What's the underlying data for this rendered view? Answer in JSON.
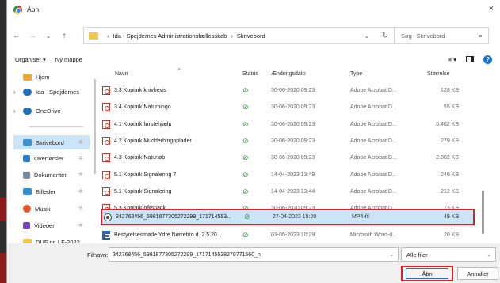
{
  "window": {
    "title": "Åbn",
    "close": "×"
  },
  "nav": {
    "back": "←",
    "forward": "→",
    "recent": "⌄",
    "up": "↑",
    "path": [
      "Ida - Spejdernes Administrationsfællesskab",
      "Skrivebord"
    ],
    "search_placeholder": "Søg i Skrivebord"
  },
  "toolbar": {
    "organize": "Organiser ▾",
    "new_folder": "Ny mappe"
  },
  "sidebar": {
    "items": [
      {
        "label": "Hjem",
        "icon": "home-icon",
        "color": "#f0a830"
      },
      {
        "label": "Ida - Spejdernes",
        "icon": "cloud-icon",
        "color": "#1f6fb8",
        "expand": "›"
      },
      {
        "label": "OneDrive",
        "icon": "cloud-icon",
        "color": "#1f6fb8",
        "expand": "›"
      },
      {
        "label": "Skrivebord",
        "icon": "desktop-icon",
        "color": "#3d8fd1",
        "pin": "✲",
        "selected": true
      },
      {
        "label": "Overførsler",
        "icon": "download-icon",
        "color": "#2a7bd1",
        "pin": "✲"
      },
      {
        "label": "Dokumenter",
        "icon": "document-icon",
        "color": "#7a8aa0",
        "pin": "✲"
      },
      {
        "label": "Billeder",
        "icon": "pictures-icon",
        "color": "#2f8fd6",
        "pin": "✲"
      },
      {
        "label": "Musik",
        "icon": "music-icon",
        "color": "#e2542a",
        "pin": "✲"
      },
      {
        "label": "Videoer",
        "icon": "video-icon",
        "color": "#7b3fc4",
        "pin": "✲"
      },
      {
        "label": "DUF nr. LF-2022",
        "icon": "folder-icon",
        "color": "#f2c84b"
      }
    ]
  },
  "columns": {
    "name": "Navn",
    "status": "Status",
    "date": "Ændringsdato",
    "type": "Type",
    "size": "Størrelse"
  },
  "files": [
    {
      "name": "3.3 Kopiark knivbevis",
      "status": "⊘",
      "date": "30-06-2020 09:23",
      "type": "Adobe Acrobat D...",
      "size": "128 KB",
      "kind": "pdf"
    },
    {
      "name": "3.4 Kopiark Naturbingo",
      "status": "⊘",
      "date": "30-06-2020 09:23",
      "type": "Adobe Acrobat D...",
      "size": "55 KB",
      "kind": "pdf"
    },
    {
      "name": "4.1 Kopiark førstehjælp",
      "status": "⊘",
      "date": "30-06-2020 09:23",
      "type": "Adobe Acrobat D...",
      "size": "6.462 KB",
      "kind": "pdf"
    },
    {
      "name": "4.2 Kopiark Mudderbingoplader",
      "status": "⊘",
      "date": "30-06-2020 09:23",
      "type": "Adobe Acrobat D...",
      "size": "279 KB",
      "kind": "pdf"
    },
    {
      "name": "4.3 Kopiark Naturløb",
      "status": "⊘",
      "date": "30-06-2020 09:23",
      "type": "Adobe Acrobat D...",
      "size": "2.802 KB",
      "kind": "pdf"
    },
    {
      "name": "5.1 Kopiark Signalering 7",
      "status": "⊘",
      "date": "14-04-2023 13:49",
      "type": "Adobe Acrobat D...",
      "size": "240 KB",
      "kind": "pdf"
    },
    {
      "name": "5.1 Kopiark Signalering",
      "status": "⊘",
      "date": "14-04-2023 13:44",
      "type": "Adobe Acrobat D...",
      "size": "212 KB",
      "kind": "pdf"
    },
    {
      "name": "5.3 Kopiark bålsnack",
      "status": "⊘",
      "date": "30-06-2020 09:23",
      "type": "Adobe Acrobat D...",
      "size": "73 KB",
      "kind": "pdf"
    },
    {
      "name": "342768456_5981877305272299_171714553...",
      "status": "⊘",
      "date": "27-04-2023 15:20",
      "type": "MP4-fil",
      "size": "49 KB",
      "kind": "mp4",
      "highlight": true
    },
    {
      "name": "Bestyrelsesmøde Ydre Nørrebro d. 2.5.20...",
      "status": "⊘",
      "date": "03-05-2023 10:29",
      "type": "Microsoft Word-d...",
      "size": "20 KB",
      "kind": "doc"
    }
  ],
  "bottom": {
    "filename_label": "Filnavn:",
    "filename_value": "342768456_5981877305272299_1717145538279771560_n",
    "filter": "Alle filer",
    "open": "Åbn",
    "cancel": "Annuller"
  }
}
